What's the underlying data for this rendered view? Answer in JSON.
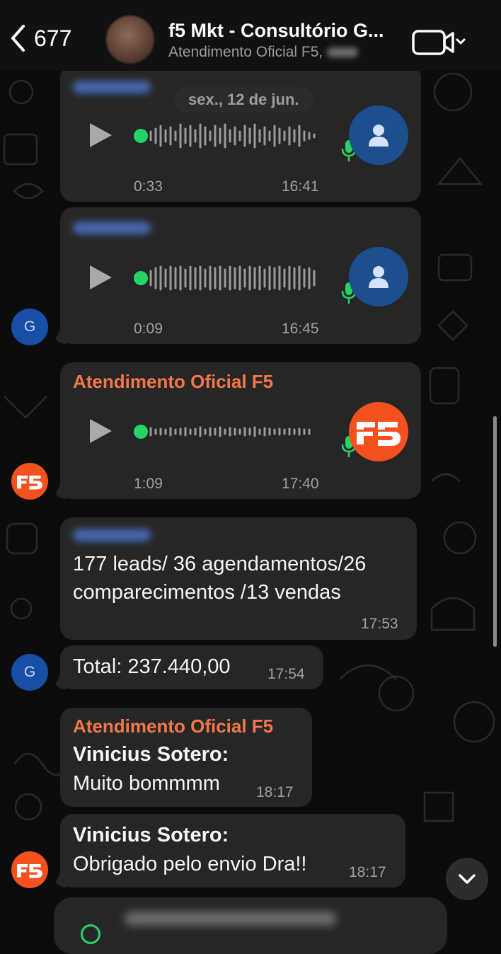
{
  "header": {
    "back_count": "677",
    "title": "f5 Mkt - Consultório G...",
    "subtitle": "Atendimento Oficial F5,"
  },
  "date_chip": "sex., 12 de jun.",
  "messages": [
    {
      "type": "audio",
      "duration": "0:33",
      "time": "16:41"
    },
    {
      "type": "audio",
      "duration": "0:09",
      "time": "16:45",
      "avatar": "G"
    },
    {
      "type": "audio",
      "sender": "Atendimento Oficial F5",
      "duration": "1:09",
      "time": "17:40"
    },
    {
      "type": "text",
      "lines": [
        "177 leads/ 36 agendamentos/26",
        "comparecimentos /13 vendas"
      ],
      "time": "17:53"
    },
    {
      "type": "text",
      "text": "Total: 237.440,00",
      "time": "17:54",
      "avatar": "G"
    },
    {
      "type": "text",
      "sender": "Atendimento Oficial F5",
      "author": "Vinicius Sotero:",
      "text": "Muito bommmm",
      "time": "18:17"
    },
    {
      "type": "text",
      "author": "Vinicius Sotero:",
      "text": "Obrigado pelo envio Dra!!",
      "time": "18:17"
    }
  ],
  "colors": {
    "background": "#0c0c0c",
    "bubble": "#262626",
    "sender_orange": "#f2784b",
    "waveform_dot": "#25d366",
    "contact_avatar": "#1d4f8f",
    "f5_brand": "#f4511e",
    "group_avatar_blue": "#174ea6"
  },
  "icons": [
    "chevron-left-icon",
    "video-camera-icon",
    "chevron-down-icon",
    "play-icon",
    "microphone-icon",
    "person-icon",
    "f5-logo-icon"
  ]
}
